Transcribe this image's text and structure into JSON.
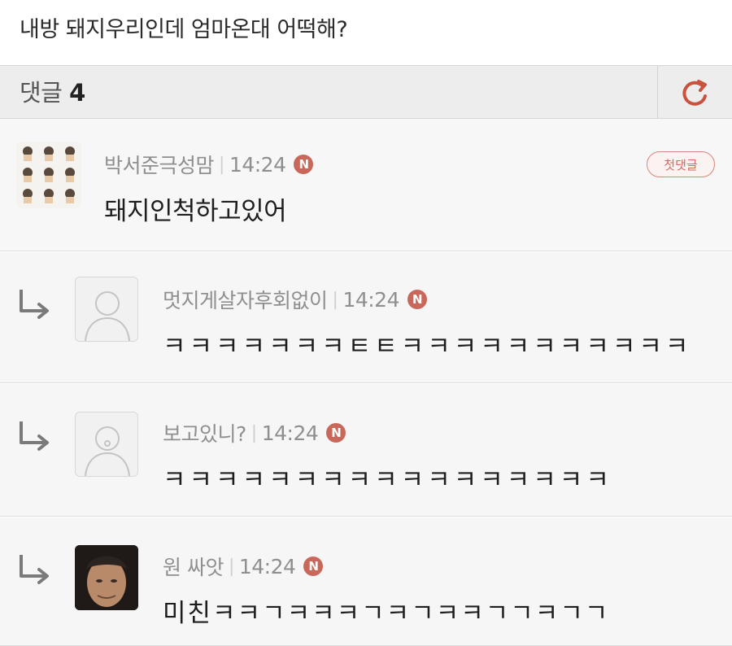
{
  "post": {
    "title": "내방 돼지우리인데 엄마온대 어떡해?"
  },
  "comments_header": {
    "label": "댓글",
    "count": "4"
  },
  "comments": [
    {
      "author": "박서준극성맘",
      "time": "14:24",
      "badge": "N",
      "text": "돼지인척하고있어",
      "tag": "첫댓글",
      "is_reply": false
    },
    {
      "author": "멋지게살자후회없이",
      "time": "14:24",
      "badge": "N",
      "text": "ㅋㅋㅋㅋㅋㅋㅋㅌㅌㅋㅋㅋㅋㅋㅋㅋㅋㅋㅋㅋ",
      "is_reply": true
    },
    {
      "author": "보고있니?",
      "time": "14:24",
      "badge": "N",
      "text": "ㅋㅋㅋㅋㅋㅋㅋㅋㅋㅋㅋㅋㅋㅋㅋㅋㅋ",
      "is_reply": true
    },
    {
      "author": "원 싸앗",
      "time": "14:24",
      "badge": "N",
      "text": "미친ㅋㅋㄱㅋㅋㅋㄱㅋㄱㅋㅋㄱㄱㅋㄱㄱ",
      "is_reply": true
    }
  ],
  "colors": {
    "accent": "#c9685a",
    "header_bg": "#ededed",
    "row_bg": "#f6f6f6"
  },
  "icons": {
    "refresh": "refresh-icon",
    "reply": "reply-arrow-icon",
    "new": "new-badge-icon"
  }
}
